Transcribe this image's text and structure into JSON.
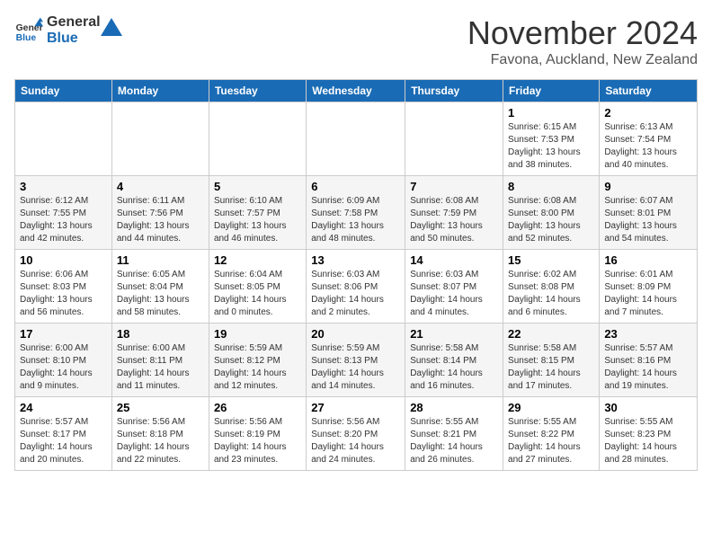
{
  "logo": {
    "line1": "General",
    "line2": "Blue"
  },
  "title": "November 2024",
  "subtitle": "Favona, Auckland, New Zealand",
  "days_of_week": [
    "Sunday",
    "Monday",
    "Tuesday",
    "Wednesday",
    "Thursday",
    "Friday",
    "Saturday"
  ],
  "weeks": [
    [
      {
        "day": "",
        "info": ""
      },
      {
        "day": "",
        "info": ""
      },
      {
        "day": "",
        "info": ""
      },
      {
        "day": "",
        "info": ""
      },
      {
        "day": "",
        "info": ""
      },
      {
        "day": "1",
        "info": "Sunrise: 6:15 AM\nSunset: 7:53 PM\nDaylight: 13 hours\nand 38 minutes."
      },
      {
        "day": "2",
        "info": "Sunrise: 6:13 AM\nSunset: 7:54 PM\nDaylight: 13 hours\nand 40 minutes."
      }
    ],
    [
      {
        "day": "3",
        "info": "Sunrise: 6:12 AM\nSunset: 7:55 PM\nDaylight: 13 hours\nand 42 minutes."
      },
      {
        "day": "4",
        "info": "Sunrise: 6:11 AM\nSunset: 7:56 PM\nDaylight: 13 hours\nand 44 minutes."
      },
      {
        "day": "5",
        "info": "Sunrise: 6:10 AM\nSunset: 7:57 PM\nDaylight: 13 hours\nand 46 minutes."
      },
      {
        "day": "6",
        "info": "Sunrise: 6:09 AM\nSunset: 7:58 PM\nDaylight: 13 hours\nand 48 minutes."
      },
      {
        "day": "7",
        "info": "Sunrise: 6:08 AM\nSunset: 7:59 PM\nDaylight: 13 hours\nand 50 minutes."
      },
      {
        "day": "8",
        "info": "Sunrise: 6:08 AM\nSunset: 8:00 PM\nDaylight: 13 hours\nand 52 minutes."
      },
      {
        "day": "9",
        "info": "Sunrise: 6:07 AM\nSunset: 8:01 PM\nDaylight: 13 hours\nand 54 minutes."
      }
    ],
    [
      {
        "day": "10",
        "info": "Sunrise: 6:06 AM\nSunset: 8:03 PM\nDaylight: 13 hours\nand 56 minutes."
      },
      {
        "day": "11",
        "info": "Sunrise: 6:05 AM\nSunset: 8:04 PM\nDaylight: 13 hours\nand 58 minutes."
      },
      {
        "day": "12",
        "info": "Sunrise: 6:04 AM\nSunset: 8:05 PM\nDaylight: 14 hours\nand 0 minutes."
      },
      {
        "day": "13",
        "info": "Sunrise: 6:03 AM\nSunset: 8:06 PM\nDaylight: 14 hours\nand 2 minutes."
      },
      {
        "day": "14",
        "info": "Sunrise: 6:03 AM\nSunset: 8:07 PM\nDaylight: 14 hours\nand 4 minutes."
      },
      {
        "day": "15",
        "info": "Sunrise: 6:02 AM\nSunset: 8:08 PM\nDaylight: 14 hours\nand 6 minutes."
      },
      {
        "day": "16",
        "info": "Sunrise: 6:01 AM\nSunset: 8:09 PM\nDaylight: 14 hours\nand 7 minutes."
      }
    ],
    [
      {
        "day": "17",
        "info": "Sunrise: 6:00 AM\nSunset: 8:10 PM\nDaylight: 14 hours\nand 9 minutes."
      },
      {
        "day": "18",
        "info": "Sunrise: 6:00 AM\nSunset: 8:11 PM\nDaylight: 14 hours\nand 11 minutes."
      },
      {
        "day": "19",
        "info": "Sunrise: 5:59 AM\nSunset: 8:12 PM\nDaylight: 14 hours\nand 12 minutes."
      },
      {
        "day": "20",
        "info": "Sunrise: 5:59 AM\nSunset: 8:13 PM\nDaylight: 14 hours\nand 14 minutes."
      },
      {
        "day": "21",
        "info": "Sunrise: 5:58 AM\nSunset: 8:14 PM\nDaylight: 14 hours\nand 16 minutes."
      },
      {
        "day": "22",
        "info": "Sunrise: 5:58 AM\nSunset: 8:15 PM\nDaylight: 14 hours\nand 17 minutes."
      },
      {
        "day": "23",
        "info": "Sunrise: 5:57 AM\nSunset: 8:16 PM\nDaylight: 14 hours\nand 19 minutes."
      }
    ],
    [
      {
        "day": "24",
        "info": "Sunrise: 5:57 AM\nSunset: 8:17 PM\nDaylight: 14 hours\nand 20 minutes."
      },
      {
        "day": "25",
        "info": "Sunrise: 5:56 AM\nSunset: 8:18 PM\nDaylight: 14 hours\nand 22 minutes."
      },
      {
        "day": "26",
        "info": "Sunrise: 5:56 AM\nSunset: 8:19 PM\nDaylight: 14 hours\nand 23 minutes."
      },
      {
        "day": "27",
        "info": "Sunrise: 5:56 AM\nSunset: 8:20 PM\nDaylight: 14 hours\nand 24 minutes."
      },
      {
        "day": "28",
        "info": "Sunrise: 5:55 AM\nSunset: 8:21 PM\nDaylight: 14 hours\nand 26 minutes."
      },
      {
        "day": "29",
        "info": "Sunrise: 5:55 AM\nSunset: 8:22 PM\nDaylight: 14 hours\nand 27 minutes."
      },
      {
        "day": "30",
        "info": "Sunrise: 5:55 AM\nSunset: 8:23 PM\nDaylight: 14 hours\nand 28 minutes."
      }
    ]
  ],
  "colors": {
    "header_bg": "#1a6bb5",
    "header_text": "#ffffff",
    "border": "#cccccc",
    "row_even": "#f5f5f5",
    "row_odd": "#ffffff"
  }
}
